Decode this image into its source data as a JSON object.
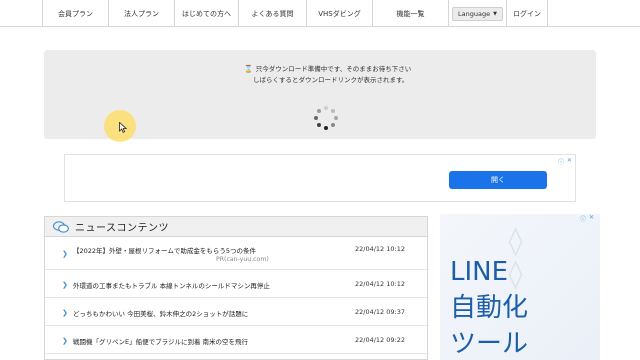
{
  "nav": {
    "items": [
      "会員プラン",
      "法人プラン",
      "はじめての方へ",
      "よくある質問",
      "VHSダビング",
      "機能一覧"
    ],
    "language_label": "Language",
    "login_label": "ログイン"
  },
  "download": {
    "line1": "只今ダウンロード準備中です、そのままお待ち下さい",
    "line2": "しばらくするとダウンロードリンクが表示されます。"
  },
  "ad_top": {
    "button_label": "開く"
  },
  "news": {
    "title": "ニュースコンテンツ",
    "items": [
      {
        "text": "【2022年】外壁・屋根リフォームで助成金をもらう5つの条件",
        "date": "22/04/12 10:12",
        "sub": "PR(can-yuu.com)"
      },
      {
        "text": "外環道の工事またもトラブル 本線トンネルのシールドマシン再停止",
        "date": "22/04/12 10:12"
      },
      {
        "text": "どっちもかわいい 今田美桜、鈴木伸之の2ショットが話題に",
        "date": "22/04/12 09:37"
      },
      {
        "text": "戦闘機「グリペンE」船便でブラジルに到着 南米の空を飛行",
        "date": "22/04/12 09:22"
      }
    ]
  },
  "side_ad": {
    "lines": [
      "LINE",
      "自動化",
      "ツール"
    ]
  },
  "colors": {
    "accent": "#1a73e8",
    "arrow": "#3b8ccf",
    "side_ad_text": "#1d5ea8",
    "cursor_highlight": "#ffdc5a"
  }
}
